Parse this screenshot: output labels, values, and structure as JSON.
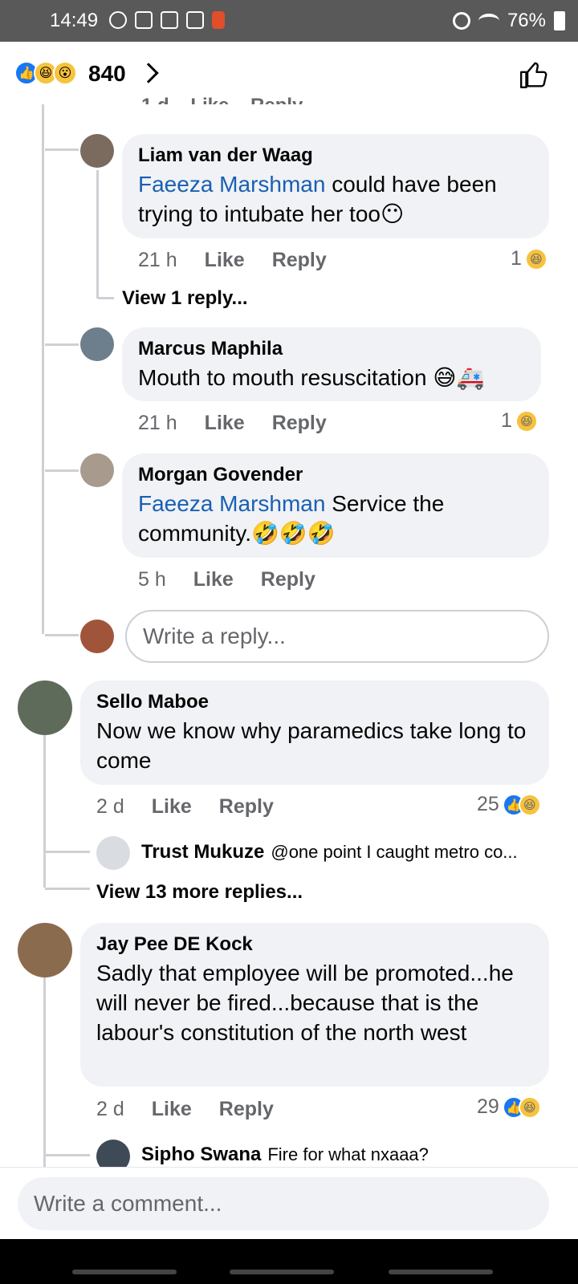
{
  "status_bar": {
    "time": "14:49",
    "battery": "76%"
  },
  "header": {
    "reaction_count": "840"
  },
  "comments": [
    {
      "author": "Liam van der Waag",
      "mention": "Faeeza Marshman",
      "text": " could have been trying to intubate her too😶",
      "time": "21 h",
      "like": "Like",
      "reply": "Reply",
      "reactions": "1",
      "view_replies": "View 1 reply..."
    },
    {
      "author": "Marcus Maphila",
      "text": "Mouth to mouth resuscitation 😅🚑",
      "time": "21 h",
      "like": "Like",
      "reply": "Reply",
      "reactions": "1"
    },
    {
      "author": "Morgan Govender",
      "mention": "Faeeza Marshman",
      "text": " Service the community.🤣🤣🤣",
      "time": "5 h",
      "like": "Like",
      "reply": "Reply"
    },
    {
      "author": "Sello Maboe",
      "text": "Now we know why paramedics take long to come",
      "time": "2 d",
      "like": "Like",
      "reply": "Reply",
      "reactions": "25",
      "preview_reply": {
        "author": "Trust Mukuze",
        "text": "@one point I caught metro co..."
      },
      "view_replies": "View 13 more replies..."
    },
    {
      "author": "Jay Pee DE Kock",
      "text": "Sadly  that employee will  be promoted...he will never  be fired...because  that is the labour's constitution of the north west",
      "time": "2 d",
      "like": "Like",
      "reply": "Reply",
      "reactions": "29",
      "preview_reply": {
        "author": "Sipho Swana",
        "text": "Fire for what  nxaaa?"
      }
    }
  ],
  "reply_input": {
    "placeholder": "Write a reply..."
  },
  "comment_input": {
    "placeholder": "Write a comment..."
  },
  "colors": {
    "mention": "#1a5fb4",
    "bubble": "#f0f2f5",
    "like_blue": "#1877f2",
    "laugh_yellow": "#f7c23c"
  }
}
